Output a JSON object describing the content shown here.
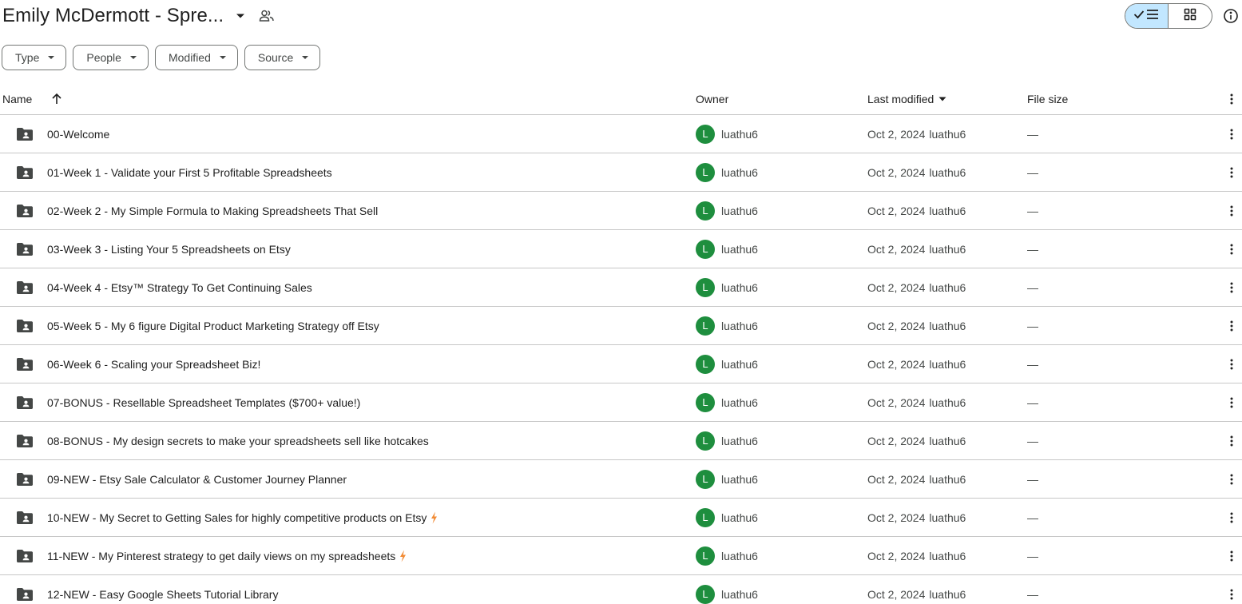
{
  "header": {
    "title": "Emily McDermott - Spre...",
    "title_caret_icon": "arrow-drop-down-icon",
    "shared_icon": "people-icon",
    "view_toggle": {
      "list_icon": "check-list-icon",
      "grid_icon": "grid-icon",
      "active": "list"
    },
    "info_icon": "info-icon"
  },
  "filters": [
    {
      "label": "Type"
    },
    {
      "label": "People"
    },
    {
      "label": "Modified"
    },
    {
      "label": "Source"
    }
  ],
  "columns": {
    "name": "Name",
    "owner": "Owner",
    "last_modified": "Last modified",
    "file_size": "File size"
  },
  "colors": {
    "avatar_bg": "#1e8e3e",
    "toggle_active_bg": "#c2e7ff",
    "bolt": "#f28b34"
  },
  "rows": [
    {
      "name": "00-Welcome",
      "bolt": false,
      "owner_initial": "L",
      "owner": "luathu6",
      "modified_date": "Oct 2, 2024",
      "modified_by": "luathu6",
      "size": "—"
    },
    {
      "name": "01-Week 1 - Validate your First 5 Profitable Spreadsheets",
      "bolt": false,
      "owner_initial": "L",
      "owner": "luathu6",
      "modified_date": "Oct 2, 2024",
      "modified_by": "luathu6",
      "size": "—"
    },
    {
      "name": "02-Week 2 - My Simple Formula to Making Spreadsheets That Sell",
      "bolt": false,
      "owner_initial": "L",
      "owner": "luathu6",
      "modified_date": "Oct 2, 2024",
      "modified_by": "luathu6",
      "size": "—"
    },
    {
      "name": "03-Week 3 - Listing Your 5 Spreadsheets on Etsy",
      "bolt": false,
      "owner_initial": "L",
      "owner": "luathu6",
      "modified_date": "Oct 2, 2024",
      "modified_by": "luathu6",
      "size": "—"
    },
    {
      "name": "04-Week 4 - Etsy™ Strategy To Get Continuing Sales",
      "bolt": false,
      "owner_initial": "L",
      "owner": "luathu6",
      "modified_date": "Oct 2, 2024",
      "modified_by": "luathu6",
      "size": "—"
    },
    {
      "name": "05-Week 5 - My 6 figure Digital Product Marketing Strategy off Etsy",
      "bolt": false,
      "owner_initial": "L",
      "owner": "luathu6",
      "modified_date": "Oct 2, 2024",
      "modified_by": "luathu6",
      "size": "—"
    },
    {
      "name": "06-Week 6 - Scaling your Spreadsheet Biz!",
      "bolt": false,
      "owner_initial": "L",
      "owner": "luathu6",
      "modified_date": "Oct 2, 2024",
      "modified_by": "luathu6",
      "size": "—"
    },
    {
      "name": "07-BONUS - Resellable Spreadsheet Templates ($700+ value!)",
      "bolt": false,
      "owner_initial": "L",
      "owner": "luathu6",
      "modified_date": "Oct 2, 2024",
      "modified_by": "luathu6",
      "size": "—"
    },
    {
      "name": "08-BONUS - My design secrets to make your spreadsheets sell like hotcakes",
      "bolt": false,
      "owner_initial": "L",
      "owner": "luathu6",
      "modified_date": "Oct 2, 2024",
      "modified_by": "luathu6",
      "size": "—"
    },
    {
      "name": "09-NEW - Etsy Sale Calculator & Customer Journey Planner",
      "bolt": false,
      "owner_initial": "L",
      "owner": "luathu6",
      "modified_date": "Oct 2, 2024",
      "modified_by": "luathu6",
      "size": "—"
    },
    {
      "name": "10-NEW - My Secret to Getting Sales for highly competitive products on Etsy",
      "bolt": true,
      "owner_initial": "L",
      "owner": "luathu6",
      "modified_date": "Oct 2, 2024",
      "modified_by": "luathu6",
      "size": "—"
    },
    {
      "name": "11-NEW - My Pinterest strategy to get daily views on my spreadsheets",
      "bolt": true,
      "owner_initial": "L",
      "owner": "luathu6",
      "modified_date": "Oct 2, 2024",
      "modified_by": "luathu6",
      "size": "—"
    },
    {
      "name": "12-NEW - Easy Google Sheets Tutorial Library",
      "bolt": false,
      "owner_initial": "L",
      "owner": "luathu6",
      "modified_date": "Oct 2, 2024",
      "modified_by": "luathu6",
      "size": "—"
    }
  ]
}
